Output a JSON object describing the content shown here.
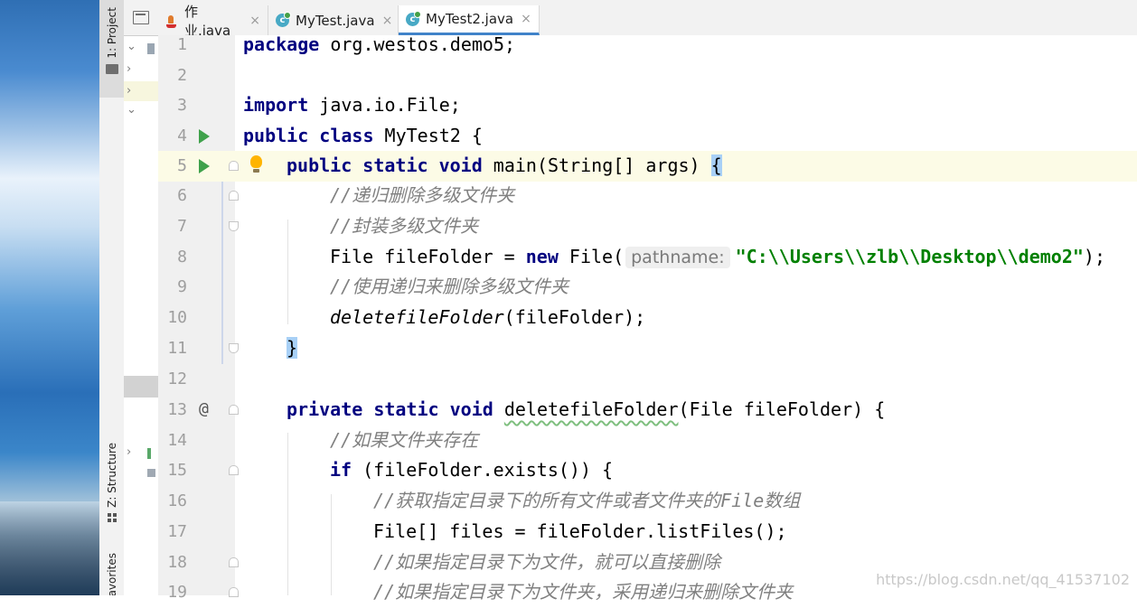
{
  "tool_windows": {
    "project": "1: Project",
    "structure": "Z: Structure",
    "favorites": "Favorites"
  },
  "tabs": [
    {
      "label": "作业.java",
      "icon": "java-file-icon",
      "close": "×",
      "active": false
    },
    {
      "label": "MyTest.java",
      "icon": "java-class-icon",
      "close": "×",
      "active": false
    },
    {
      "label": "MyTest2.java",
      "icon": "java-class-icon",
      "close": "×",
      "active": true
    }
  ],
  "editor": {
    "current_line": 5,
    "lines": [
      {
        "n": "1"
      },
      {
        "n": "2"
      },
      {
        "n": "3"
      },
      {
        "n": "4"
      },
      {
        "n": "5"
      },
      {
        "n": "6"
      },
      {
        "n": "7"
      },
      {
        "n": "8"
      },
      {
        "n": "9"
      },
      {
        "n": "10"
      },
      {
        "n": "11"
      },
      {
        "n": "12"
      },
      {
        "n": "13"
      },
      {
        "n": "14"
      },
      {
        "n": "15"
      },
      {
        "n": "16"
      },
      {
        "n": "17"
      },
      {
        "n": "18"
      },
      {
        "n": "19"
      }
    ],
    "code": {
      "l1_kw": "package",
      "l1_rest": " org.westos.demo5;",
      "l3_kw": "import",
      "l3_rest": " java.io.File;",
      "l4_kw": "public class",
      "l4_rest": " MyTest2 {",
      "l5_kw": "public static void",
      "l5_rest": " main(String[] args) ",
      "l5_brace": "{",
      "l6_comment": "//递归删除多级文件夹",
      "l7_comment": "//封装多级文件夹",
      "l8_a": "File fileFolder = ",
      "l8_kw": "new",
      "l8_b": " File(",
      "l8_hint": "pathname:",
      "l8_str": "\"C:\\\\Users\\\\zlb\\\\Desktop\\\\demo2\"",
      "l8_c": ");",
      "l9_comment": "//使用递归来删除多级文件夹",
      "l10_call": "deletefileFolder",
      "l10_rest": "(fileFolder);",
      "l11_brace": "}",
      "l13_kw": "private static void",
      "l13_name": "deletefileFolder",
      "l13_rest": "(File fileFolder) {",
      "l14_comment": "//如果文件夹存在",
      "l15_kw": "if",
      "l15_rest": " (fileFolder.exists()) {",
      "l16_comment": "//获取指定目录下的所有文件或者文件夹的File数组",
      "l17_text": "File[] files = fileFolder.listFiles();",
      "l18_comment": "//如果指定目录下为文件，就可以直接删除",
      "l19_comment": "//如果指定目录下为文件夹，采用递归来删除文件夹"
    }
  },
  "watermark": "https://blog.csdn.net/qq_41537102",
  "colors": {
    "keyword": "#000080",
    "string": "#008000",
    "comment": "#808080",
    "run_gutter": "#3fa14b",
    "tab_underline": "#4083c9",
    "current_line_bg": "#fcfbe6"
  }
}
